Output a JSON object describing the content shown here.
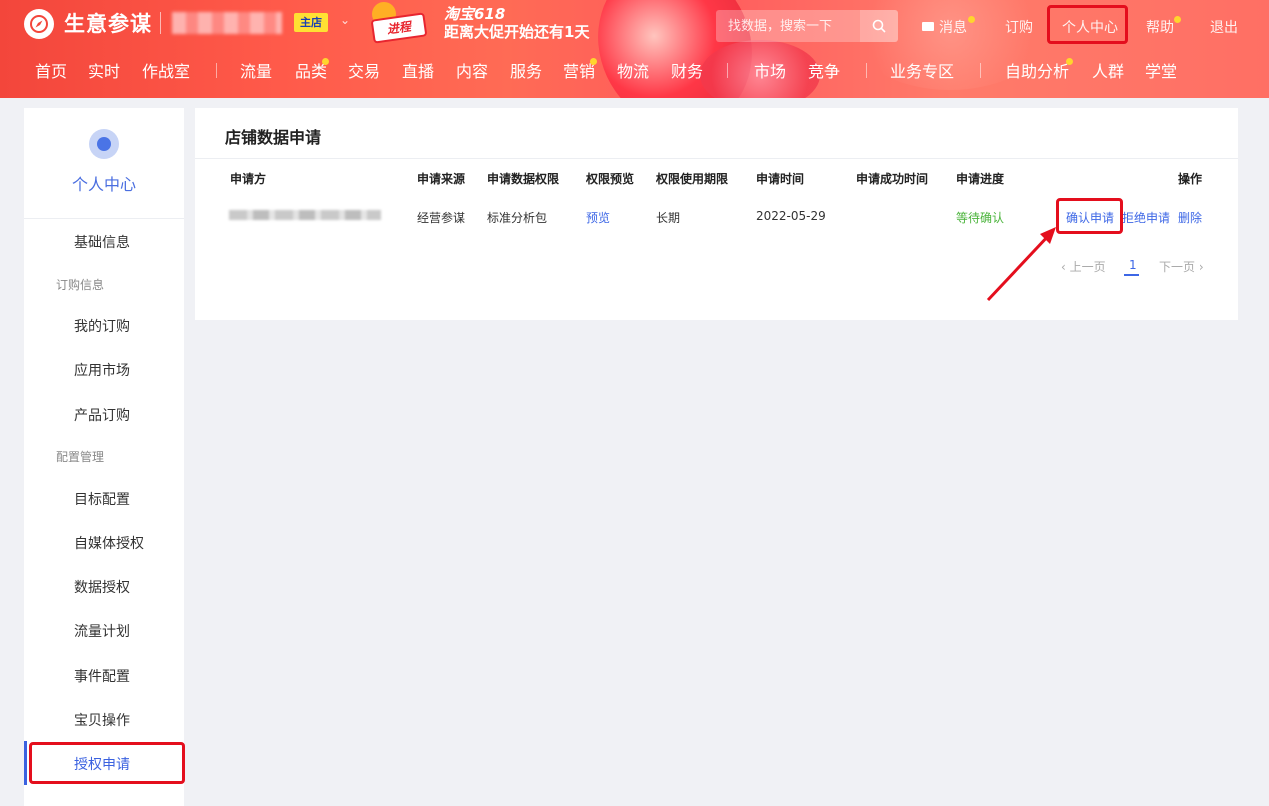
{
  "header": {
    "brand": "生意参谋",
    "shop_badge": "主店",
    "promo": {
      "mascot_label": "进程",
      "title": "淘宝618",
      "subtitle": "距离大促开始还有1天"
    },
    "search": {
      "placeholder": "找数据，搜索一下"
    },
    "links": {
      "messages": "消息",
      "subscribe": "订购",
      "personal_center": "个人中心",
      "help": "帮助",
      "logout": "退出"
    },
    "nav": [
      "首页",
      "实时",
      "作战室",
      "流量",
      "品类",
      "交易",
      "直播",
      "内容",
      "服务",
      "营销",
      "物流",
      "财务",
      "市场",
      "竞争",
      "业务专区",
      "自助分析",
      "人群",
      "学堂"
    ],
    "colors": {
      "brand_red": "#f3463b",
      "badge_yellow": "#ffe033",
      "highlight_box": "#e40e1d"
    }
  },
  "sidebar": {
    "title": "个人中心",
    "items": [
      {
        "type": "item",
        "label": "基础信息"
      },
      {
        "type": "group",
        "label": "订购信息"
      },
      {
        "type": "item",
        "label": "我的订购"
      },
      {
        "type": "item",
        "label": "应用市场"
      },
      {
        "type": "item",
        "label": "产品订购"
      },
      {
        "type": "group",
        "label": "配置管理"
      },
      {
        "type": "item",
        "label": "目标配置"
      },
      {
        "type": "item",
        "label": "自媒体授权"
      },
      {
        "type": "item",
        "label": "数据授权"
      },
      {
        "type": "item",
        "label": "流量计划"
      },
      {
        "type": "item",
        "label": "事件配置"
      },
      {
        "type": "item",
        "label": "宝贝操作"
      },
      {
        "type": "item",
        "label": "授权申请",
        "active": true
      }
    ]
  },
  "main": {
    "title": "店铺数据申请",
    "columns": [
      "申请方",
      "申请来源",
      "申请数据权限",
      "权限预览",
      "权限使用期限",
      "申请时间",
      "申请成功时间",
      "申请进度",
      "操作"
    ],
    "rows": [
      {
        "source": "经营参谋",
        "permission": "标准分析包",
        "preview": "预览",
        "duration": "长期",
        "apply_time": "2022-05-29",
        "success_time": "",
        "progress": "等待确认",
        "actions": {
          "confirm": "确认申请",
          "reject": "拒绝申请",
          "delete": "删除"
        }
      }
    ],
    "pagination": {
      "prev": "上一页",
      "page": "1",
      "next": "下一页"
    }
  }
}
